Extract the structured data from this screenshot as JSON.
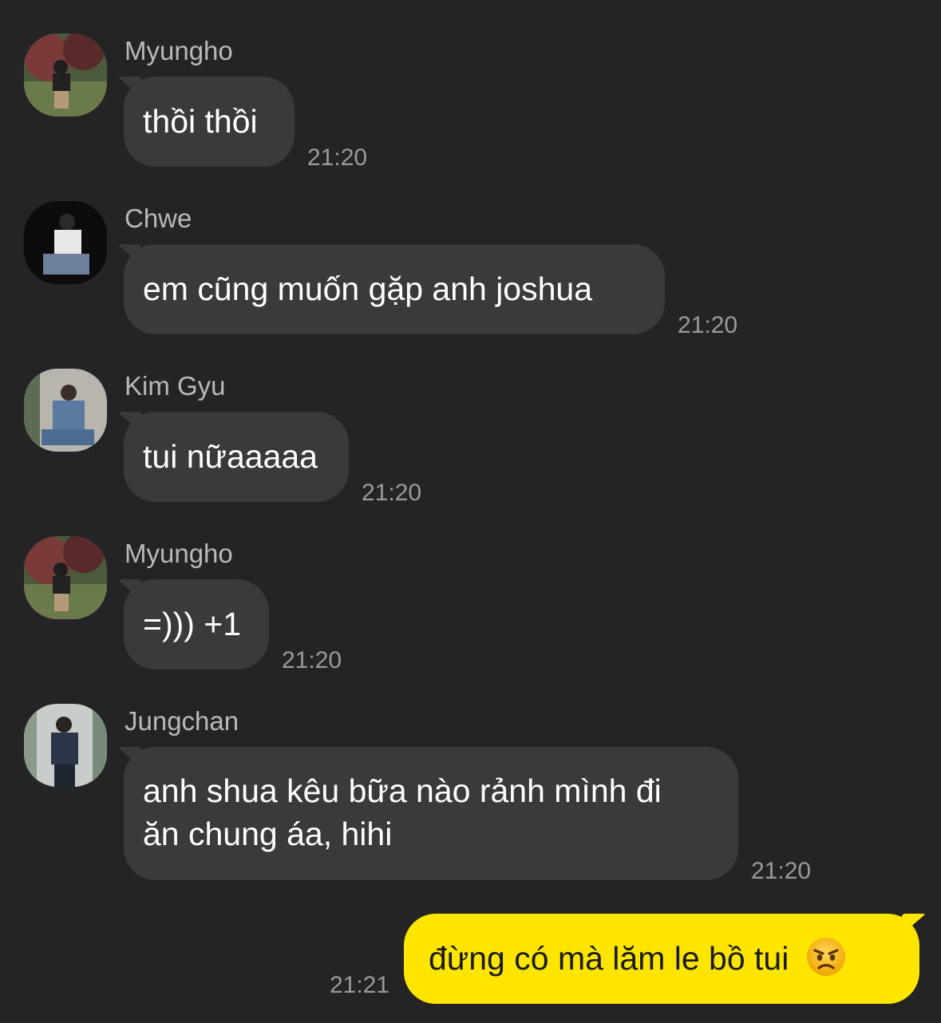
{
  "messages": [
    {
      "sender": "Myungho",
      "text": "thồi thồi",
      "time": "21:20"
    },
    {
      "sender": "Chwe",
      "text": "em cũng muốn gặp anh joshua",
      "time": "21:20"
    },
    {
      "sender": "Kim Gyu",
      "text": "tui nữaaaaa",
      "time": "21:20"
    },
    {
      "sender": "Myungho",
      "text": "=))) +1",
      "time": "21:20"
    },
    {
      "sender": "Jungchan",
      "text_line1": "anh shua kêu bữa nào rảnh mình đi",
      "text_line2": "ăn chung áa, hihi",
      "time": "21:20"
    }
  ],
  "outgoing": {
    "text": "đừng có mà lăm le bồ tui",
    "emoji": "angry-face-icon",
    "time": "21:21"
  },
  "colors": {
    "background": "#242427",
    "incoming_bubble": "#3a3a3d",
    "outgoing_bubble": "#fee500"
  }
}
